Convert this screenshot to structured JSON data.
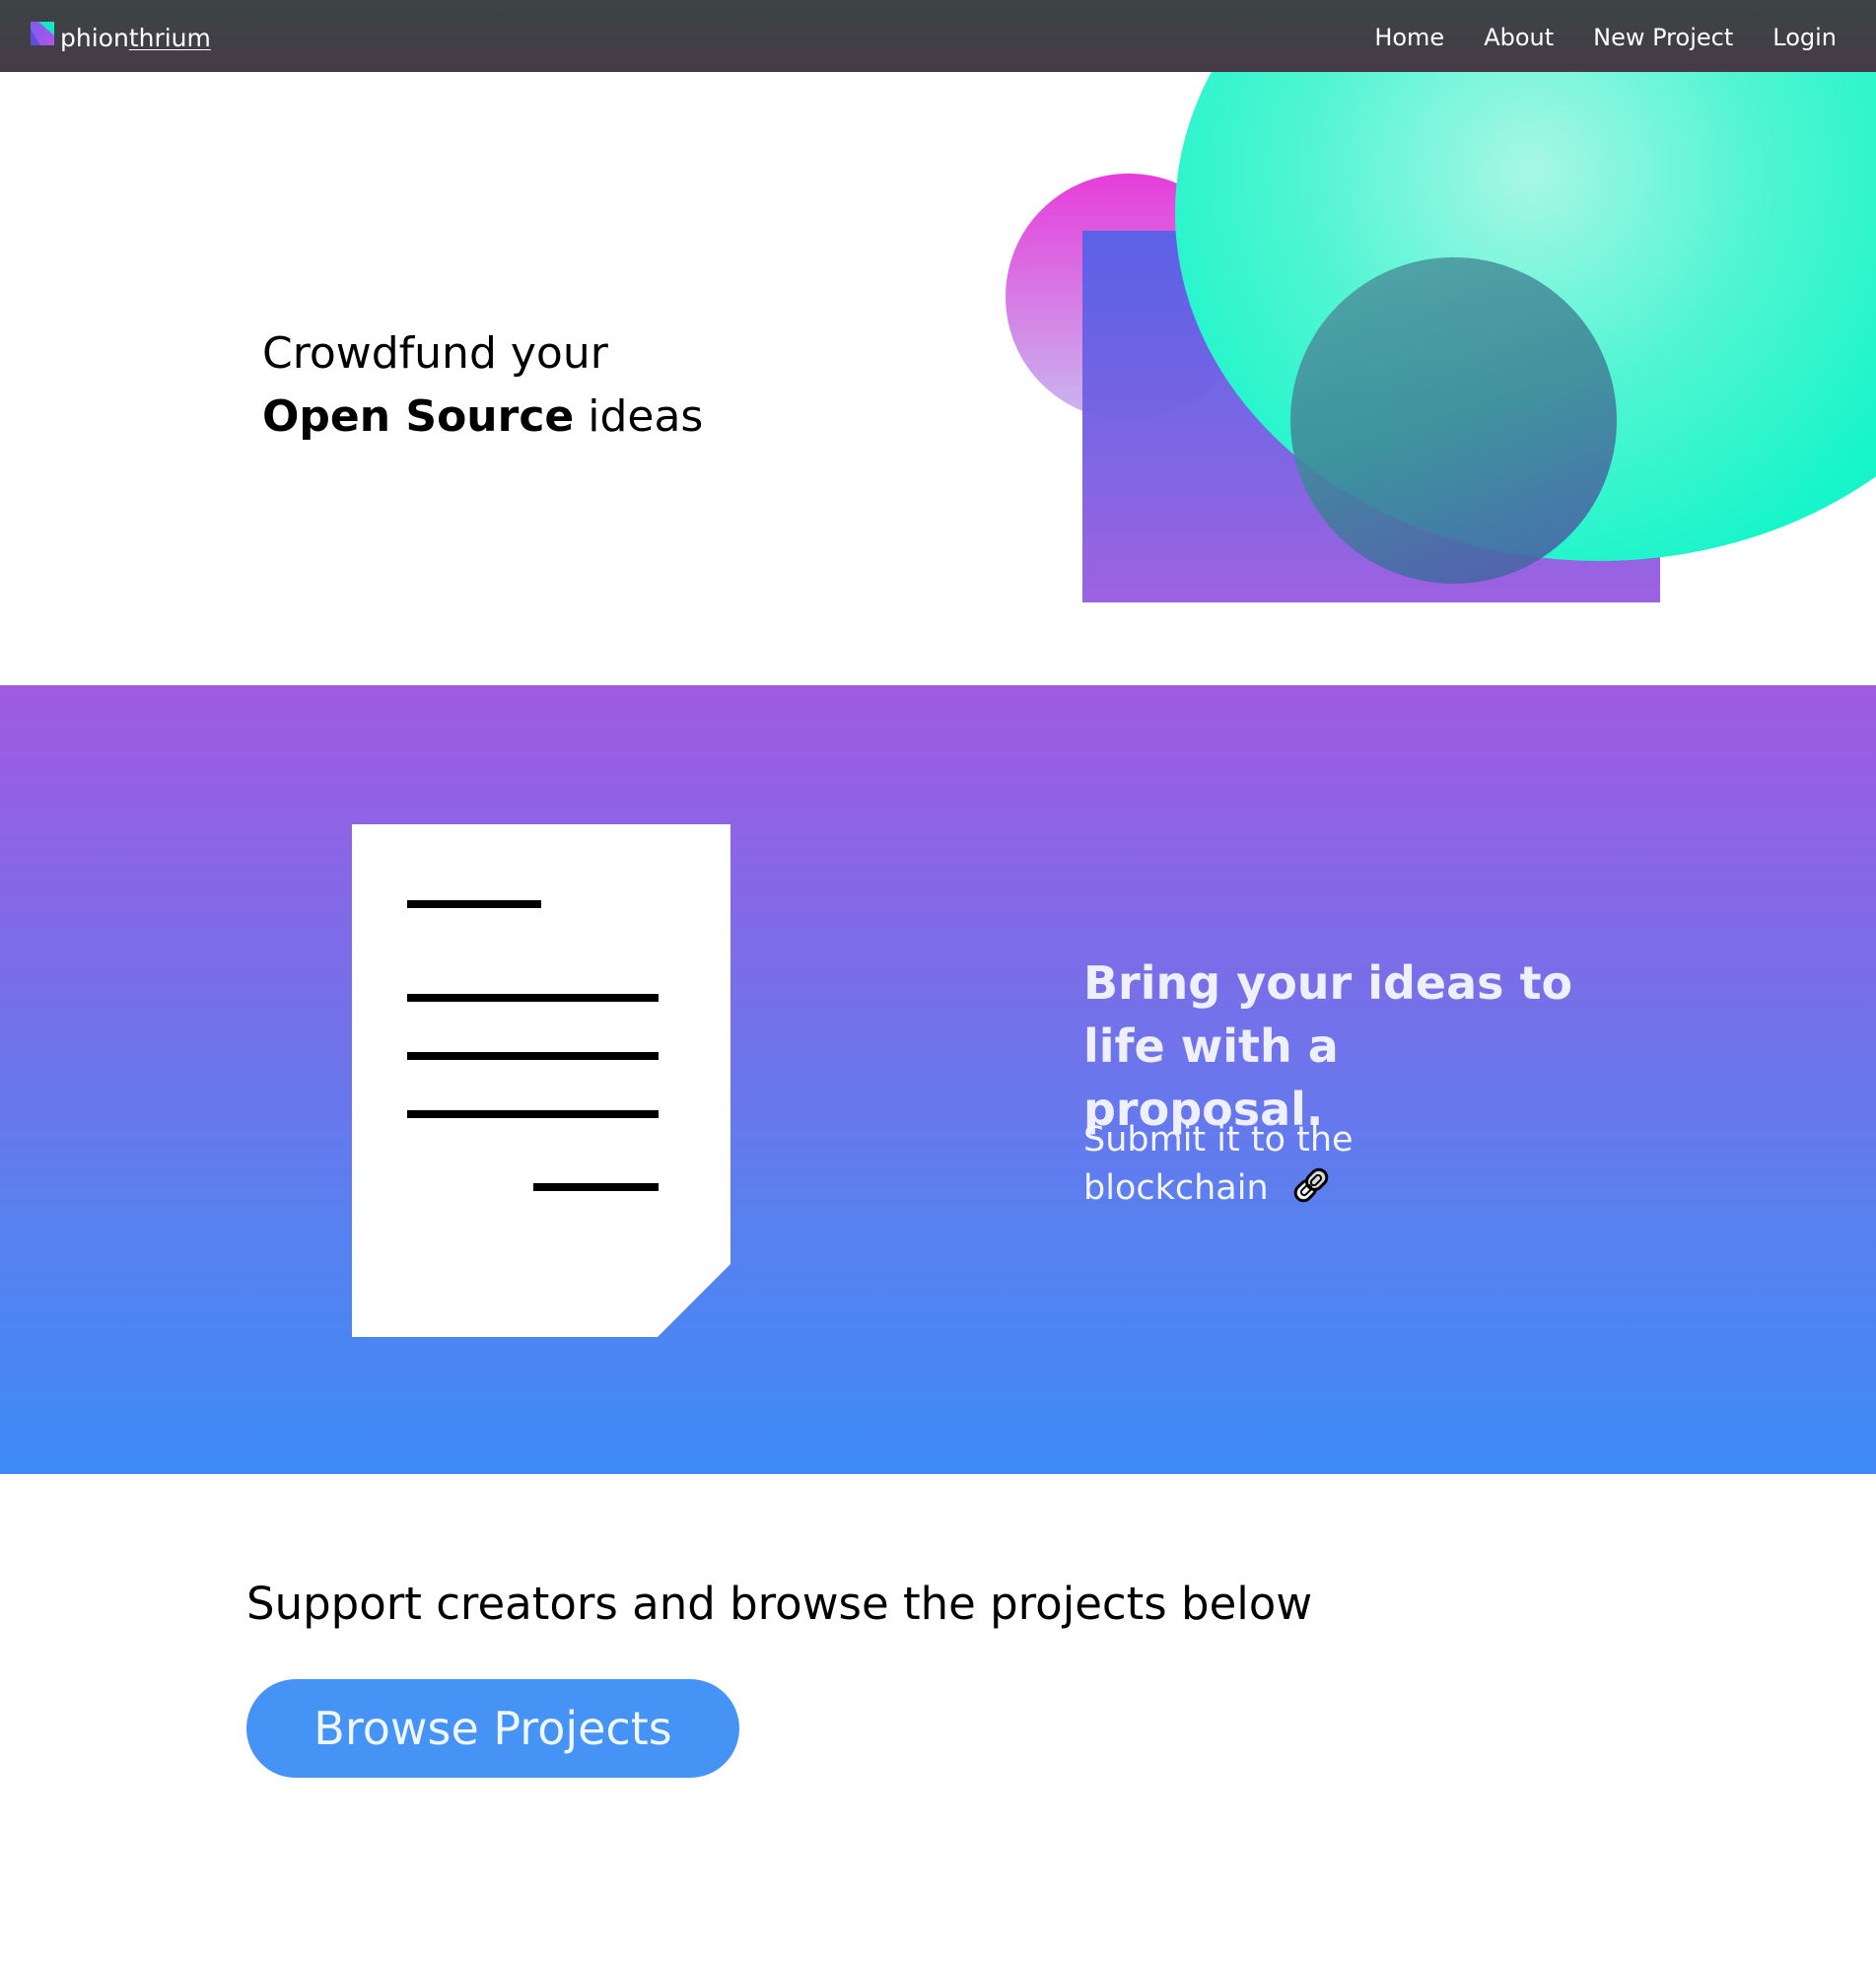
{
  "navbar": {
    "brand_prefix": "phion",
    "brand_suffix": "thrium",
    "logo_icon": "phionthrium-logo-icon",
    "links": [
      "Home",
      "About",
      "New Project",
      "Login"
    ]
  },
  "hero": {
    "line1": "Crowdfund your",
    "line2_bold": "Open Source",
    "line2_rest": " ideas",
    "colors": {
      "pink": "#e63ddb",
      "square": "#6b62e4",
      "teal": "#16f5c9",
      "teal_dark": "#3f8799"
    }
  },
  "proposal": {
    "title": "Bring your ideas to life with a proposal.",
    "subtitle": "Submit it to the blockchain",
    "document_icon": "document-icon",
    "chain_icon": "chain-link-icon",
    "gradient_top": "#a15be2",
    "gradient_bottom": "#3e8bf6"
  },
  "support": {
    "heading": "Support creators and browse the projects below",
    "button_label": "Browse Projects",
    "button_color": "#4493f5"
  }
}
